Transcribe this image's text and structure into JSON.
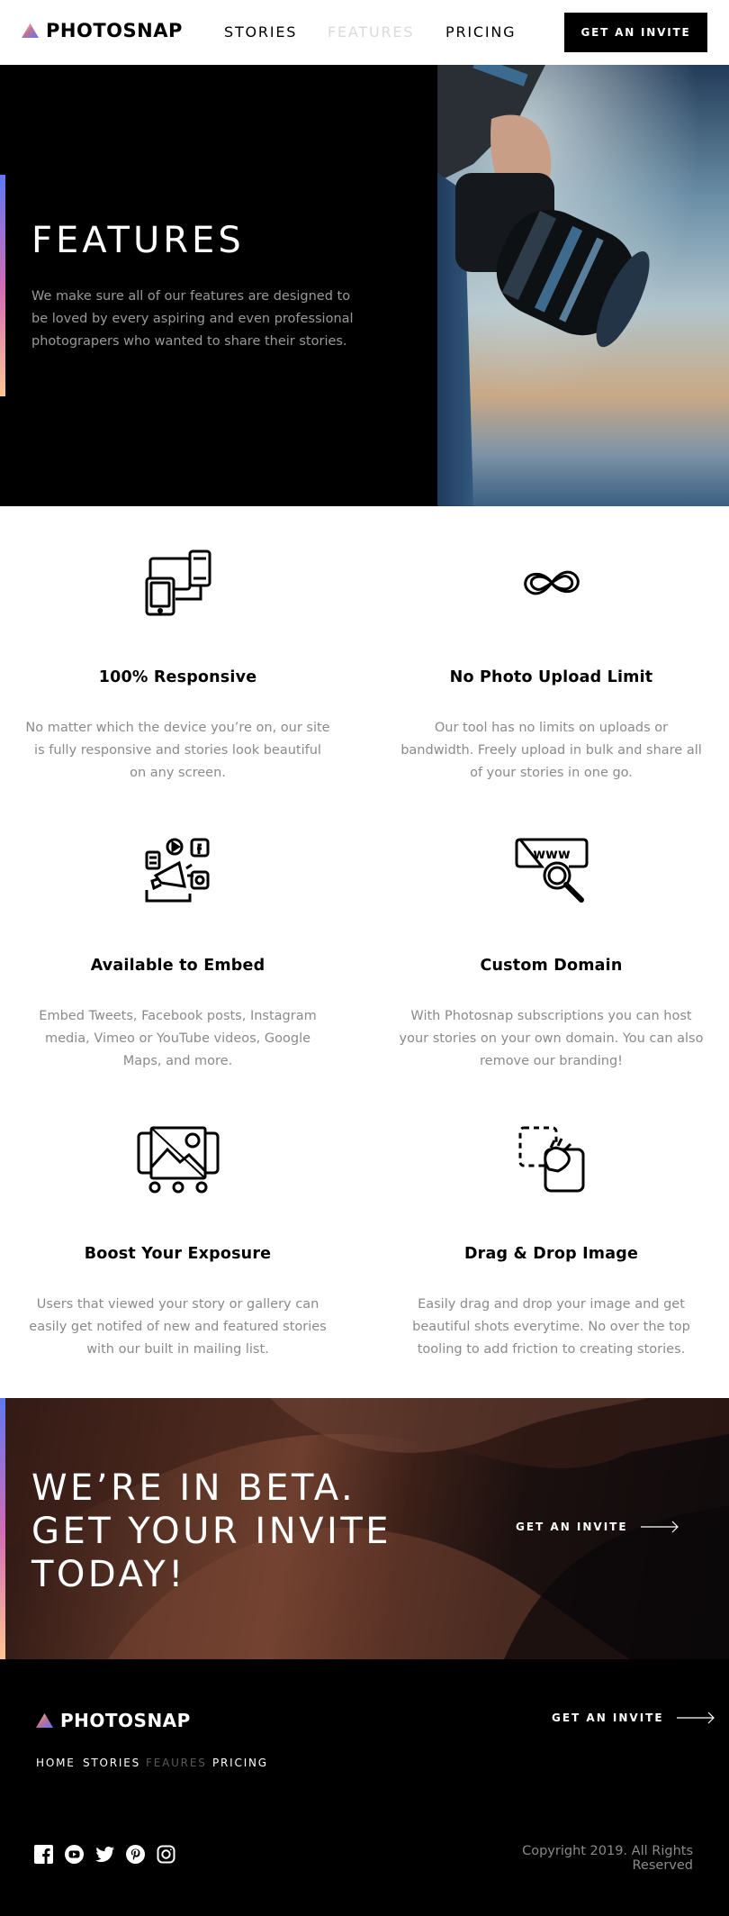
{
  "brand": {
    "name": "PHOTOSNAP",
    "colors": {
      "gradient_start": "#5e79f2",
      "gradient_mid": "#d16bb7",
      "gradient_end": "#ffc593"
    }
  },
  "header": {
    "nav": [
      {
        "label": "STORIES",
        "active": false
      },
      {
        "label": "FEATURES",
        "active": true
      },
      {
        "label": "PRICING",
        "active": false
      }
    ],
    "cta_label": "GET AN INVITE"
  },
  "hero": {
    "title": "FEATURES",
    "description": "We make sure all of our features are designed to be loved by every aspiring and even professional photograpers who wanted to share their stories."
  },
  "features": [
    {
      "icon": "responsive-devices-icon",
      "title": "100% Responsive",
      "text": "No matter which the device you’re on, our site is fully responsive and stories look beautiful on any screen."
    },
    {
      "icon": "infinity-icon",
      "title": "No Photo Upload Limit",
      "text": "Our tool has no limits on uploads or bandwidth. Freely upload in bulk and share all of your stories in one go."
    },
    {
      "icon": "embed-megaphone-icon",
      "title": "Available to Embed",
      "text": "Embed Tweets, Facebook posts, Instagram media, Vimeo or YouTube videos, Google Maps, and more."
    },
    {
      "icon": "custom-domain-icon",
      "title": "Custom Domain",
      "text": "With Photosnap subscriptions you can host your stories on your own domain. You can also remove our branding!"
    },
    {
      "icon": "boost-exposure-icon",
      "title": "Boost Your Exposure",
      "text": "Users that viewed your story or gallery can easily get notifed of new and featured stories with our built in mailing list."
    },
    {
      "icon": "drag-drop-icon",
      "title": "Drag & Drop Image",
      "text": "Easily drag and drop your image and get beautiful shots everytime. No over the top tooling to add friction to creating stories."
    }
  ],
  "beta": {
    "title": "WE’RE IN BETA. GET YOUR INVITE TODAY!",
    "link_label": "GET AN INVITE"
  },
  "footer": {
    "nav": [
      {
        "label": "HOME",
        "active": false
      },
      {
        "label": "STORIES",
        "active": false
      },
      {
        "label": "FEAURES",
        "active": true
      },
      {
        "label": "PRICING",
        "active": false
      }
    ],
    "link_label": "GET AN INVITE",
    "socials": [
      "facebook-icon",
      "youtube-icon",
      "twitter-icon",
      "pinterest-icon",
      "instagram-icon"
    ],
    "copyright": "Copyright 2019. All Rights Reserved"
  }
}
